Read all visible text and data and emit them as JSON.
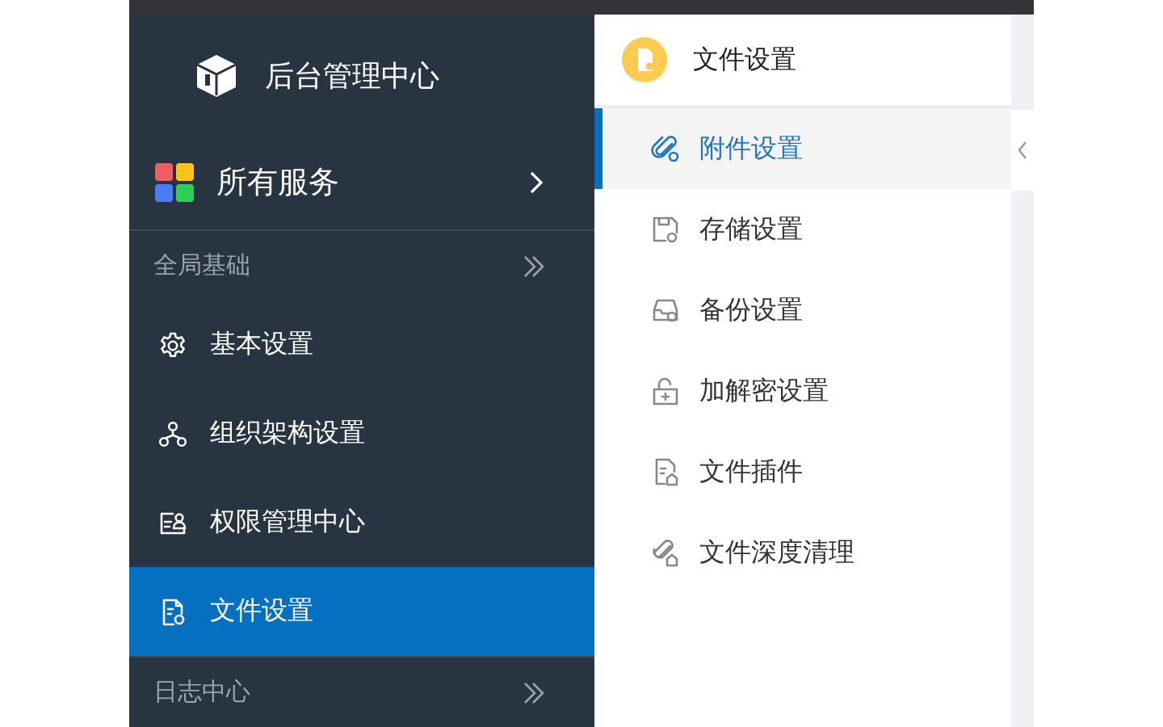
{
  "sidebar": {
    "title": "后台管理中心",
    "all_services": "所有服务",
    "sections": [
      {
        "title": "全局基础",
        "items": [
          {
            "label": "基本设置",
            "kind": "gear",
            "selected": false
          },
          {
            "label": "组织架构设置",
            "kind": "org",
            "selected": false
          },
          {
            "label": "权限管理中心",
            "kind": "permission",
            "selected": false
          },
          {
            "label": "文件设置",
            "kind": "file",
            "selected": true
          }
        ]
      },
      {
        "title": "日志中心"
      }
    ]
  },
  "submenu": {
    "title": "文件设置",
    "items": [
      {
        "label": "附件设置",
        "kind": "attach",
        "selected": true
      },
      {
        "label": "存储设置",
        "kind": "storage",
        "selected": false
      },
      {
        "label": "备份设置",
        "kind": "backup",
        "selected": false
      },
      {
        "label": "加解密设置",
        "kind": "lock",
        "selected": false
      },
      {
        "label": "文件插件",
        "kind": "plugin",
        "selected": false
      },
      {
        "label": "文件深度清理",
        "kind": "clean",
        "selected": false
      }
    ]
  }
}
